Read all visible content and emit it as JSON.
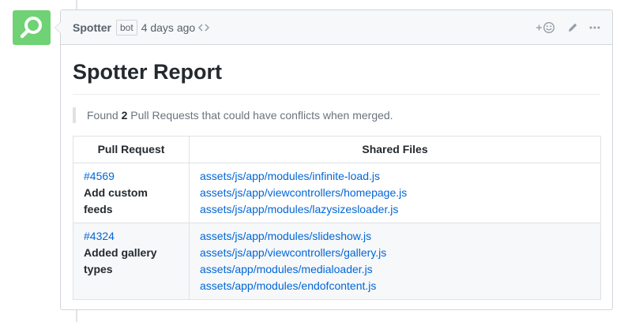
{
  "comment": {
    "author": "Spotter",
    "badge": "bot",
    "time": "4 days ago",
    "actions": {
      "reaction": "+☺"
    }
  },
  "report": {
    "title": "Spotter Report",
    "summary_prefix": "Found",
    "summary_count": "2",
    "summary_suffix": "Pull Requests that could have conflicts when merged."
  },
  "table": {
    "headers": [
      "Pull Request",
      "Shared Files"
    ],
    "rows": [
      {
        "pr_number": "#4569",
        "pr_title": "Add custom feeds",
        "files": [
          "assets/js/app/modules/infinite-load.js",
          "assets/js/app/viewcontrollers/homepage.js",
          "assets/js/app/modules/lazysizesloader.js"
        ]
      },
      {
        "pr_number": "#4324",
        "pr_title": "Added gallery types",
        "files": [
          "assets/js/app/modules/slideshow.js",
          "assets/js/app/viewcontrollers/gallery.js",
          "assets/app/modules/medialoader.js",
          "assets/app/modules/endofcontent.js"
        ]
      }
    ]
  },
  "colors": {
    "avatar": "#6fd274",
    "link": "#0366d6",
    "header_bg": "#f6f8fa"
  },
  "icons": [
    "search-icon",
    "code-icon",
    "smiley-icon",
    "pencil-icon",
    "kebab-icon"
  ]
}
